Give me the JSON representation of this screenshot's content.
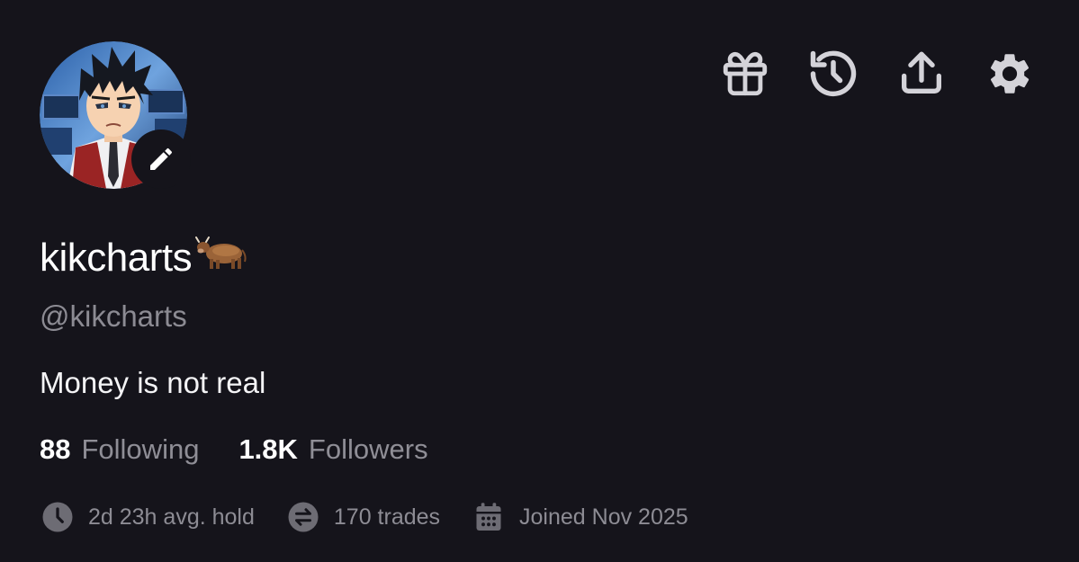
{
  "profile": {
    "display_name": "kikcharts",
    "handle": "@kikcharts",
    "bio": "Money is not real"
  },
  "header_actions": [
    {
      "name": "gift-icon"
    },
    {
      "name": "history-icon"
    },
    {
      "name": "share-icon"
    },
    {
      "name": "settings-icon"
    }
  ],
  "stats": {
    "following_count": "88",
    "following_label": "Following",
    "followers_count": "1.8K",
    "followers_label": "Followers"
  },
  "meta": {
    "avg_hold": "2d 23h avg. hold",
    "trades": "170 trades",
    "joined": "Joined Nov 2025"
  },
  "colors": {
    "background": "#15141b",
    "icon": "#d4d3d9",
    "muted_text": "#8c8b93",
    "meta_icon": "#6d6c74"
  }
}
